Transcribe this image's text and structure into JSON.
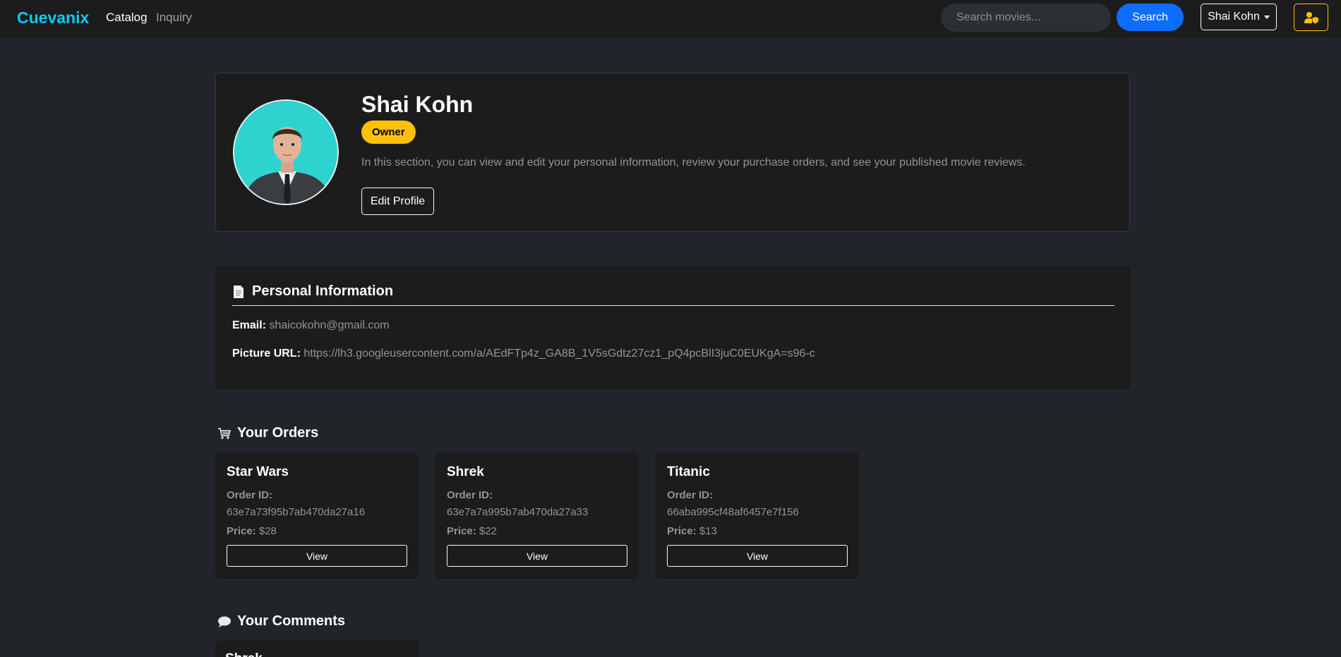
{
  "navbar": {
    "brand": "Cuevanix",
    "links": [
      "Catalog",
      "Inquiry"
    ],
    "search_placeholder": "Search movies...",
    "search_button": "Search",
    "user_menu": "Shai Kohn",
    "admin_icon": "user-shield-icon"
  },
  "profile": {
    "name": "Shai Kohn",
    "role": "Owner",
    "description": "In this section, you can view and edit your personal information, review your purchase orders, and see your published movie reviews.",
    "edit_button": "Edit Profile"
  },
  "personal_info": {
    "icon": "document-icon",
    "title": "Personal Information",
    "email_label": "Email:",
    "email": "shaicokohn@gmail.com",
    "picture_label": "Picture URL:",
    "picture_url": "https://lh3.googleusercontent.com/a/AEdFTp4z_GA8B_1V5sGdtz27cz1_pQ4pcBlI3juC0EUKgA=s96-c"
  },
  "orders": {
    "icon": "cart-icon",
    "title": "Your Orders",
    "id_label": "Order ID:",
    "price_label": "Price:",
    "view_label": "View",
    "items": [
      {
        "title": "Star Wars",
        "order_id": "63e7a73f95b7ab470da27a16",
        "price": "$28"
      },
      {
        "title": "Shrek",
        "order_id": "63e7a7a995b7ab470da27a33",
        "price": "$22"
      },
      {
        "title": "Titanic",
        "order_id": "66aba995cf48af6457e7f156",
        "price": "$13"
      }
    ]
  },
  "comments": {
    "icon": "speech-bubble-icon",
    "title": "Your Comments",
    "items": [
      {
        "title": "Shrek"
      }
    ]
  }
}
